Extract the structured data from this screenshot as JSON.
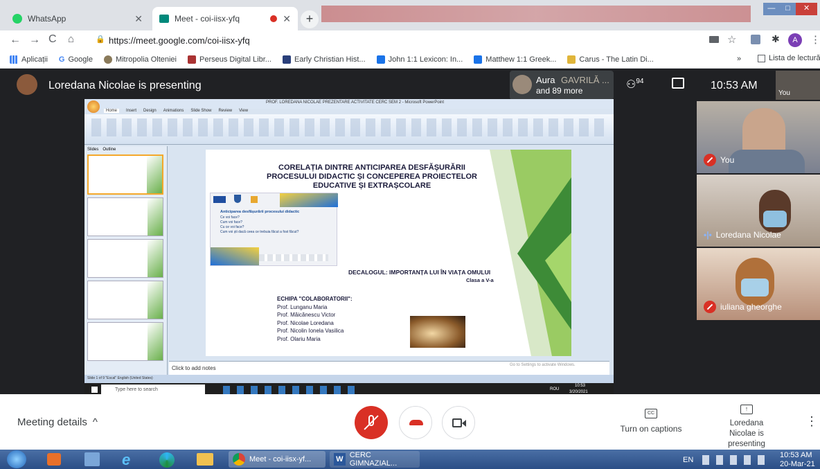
{
  "browser": {
    "tabs": [
      {
        "label": "WhatsApp",
        "icon": "whatsapp-icon"
      },
      {
        "label": "Meet - coi-iisx-yfq",
        "icon": "meet-icon"
      }
    ],
    "url": "https://meet.google.com/coi-iisx-yfq",
    "profile_initial": "A",
    "bookmarks": [
      "Aplicații",
      "Google",
      "Mitropolia Olteniei",
      "Perseus Digital Libr...",
      "Early Christian Hist...",
      "John 1:1 Lexicon: In...",
      "Matthew 1:1 Greek...",
      "Carus - The Latin Di..."
    ],
    "overflow": "»",
    "reading_list": "Lista de lectură"
  },
  "meet": {
    "presenting_title": "Loredana Nicolae is presenting",
    "chip_name": "Aura",
    "chip_name_cont": "GAVRILĂ ...",
    "chip_more": "and 89 more",
    "participant_count": "94",
    "time": "10:53 AM",
    "you_label": "You",
    "tiles": [
      {
        "name": "You",
        "muted": true
      },
      {
        "name": "Loredana Nicolae",
        "muted": false
      },
      {
        "name": "iuliana gheorghe",
        "muted": true
      }
    ],
    "meeting_details": "Meeting details",
    "captions_label": "Turn on captions",
    "captions_icon": "CC",
    "presenting_bottom": "Loredana Nicolae is presenting",
    "colors": {
      "accent_red": "#d93025",
      "bg": "#202124"
    }
  },
  "ppt": {
    "window_title": "PROF. LOREDANA NICOLAE PREZENTARE  ACTIVITATE  CERC SEM 2 - Microsoft PowerPoint",
    "ribbon_tabs": [
      "Home",
      "Insert",
      "Design",
      "Animations",
      "Slide Show",
      "Review",
      "View"
    ],
    "panel_tabs": [
      "Slides",
      "Outline"
    ],
    "notes_placeholder": "Click to add notes",
    "status": "Slide 1 of 9   \"Escal\"   English (United States)",
    "watermark": "Go to Settings to activate Windows.",
    "search_placeholder": "Type here to search",
    "clock_time": "10:53",
    "clock_date": "3/20/2021",
    "lang": "ROU",
    "thumbs": [
      "1",
      "2",
      "3",
      "4",
      "5"
    ],
    "slide": {
      "title_lines": [
        "CORELAȚIA DINTRE ANTICIPAREA DESFĂȘURĂRII",
        "PROCESULUI DIDACTIC ȘI CONCEPEREA PROIECTELOR",
        "EDUCATIVE ȘI EXTRAȘCOLARE"
      ],
      "box_title": "Anticiparea desfășurării procesului didactic",
      "box_items": [
        "Ce voi face?",
        "Cum voi face?",
        "Cu ce voi face?",
        "Cum voi ști dacă ceea ce trebuia făcut a fost făcut?"
      ],
      "decalog": "DECALOGUL: IMPORTANȚA LUI ÎN VIAȚA OMULUI",
      "clasa": "Clasa a V-a",
      "team_title": "ECHIPA \"COLABORATORII\":",
      "team": [
        "Prof. Lunganu Maria",
        "Prof. Măicănescu Victor",
        "Prof. Nicolae Loredana",
        "Prof. Nicolin Ionela Vasilica",
        "Prof. Olariu Maria"
      ]
    }
  },
  "taskbar": {
    "items": [
      "Meet - coi-iisx-yf...",
      "CERC GIMNAZIAL..."
    ],
    "lang": "EN",
    "time": "10:53 AM",
    "date": "20-Mar-21"
  }
}
